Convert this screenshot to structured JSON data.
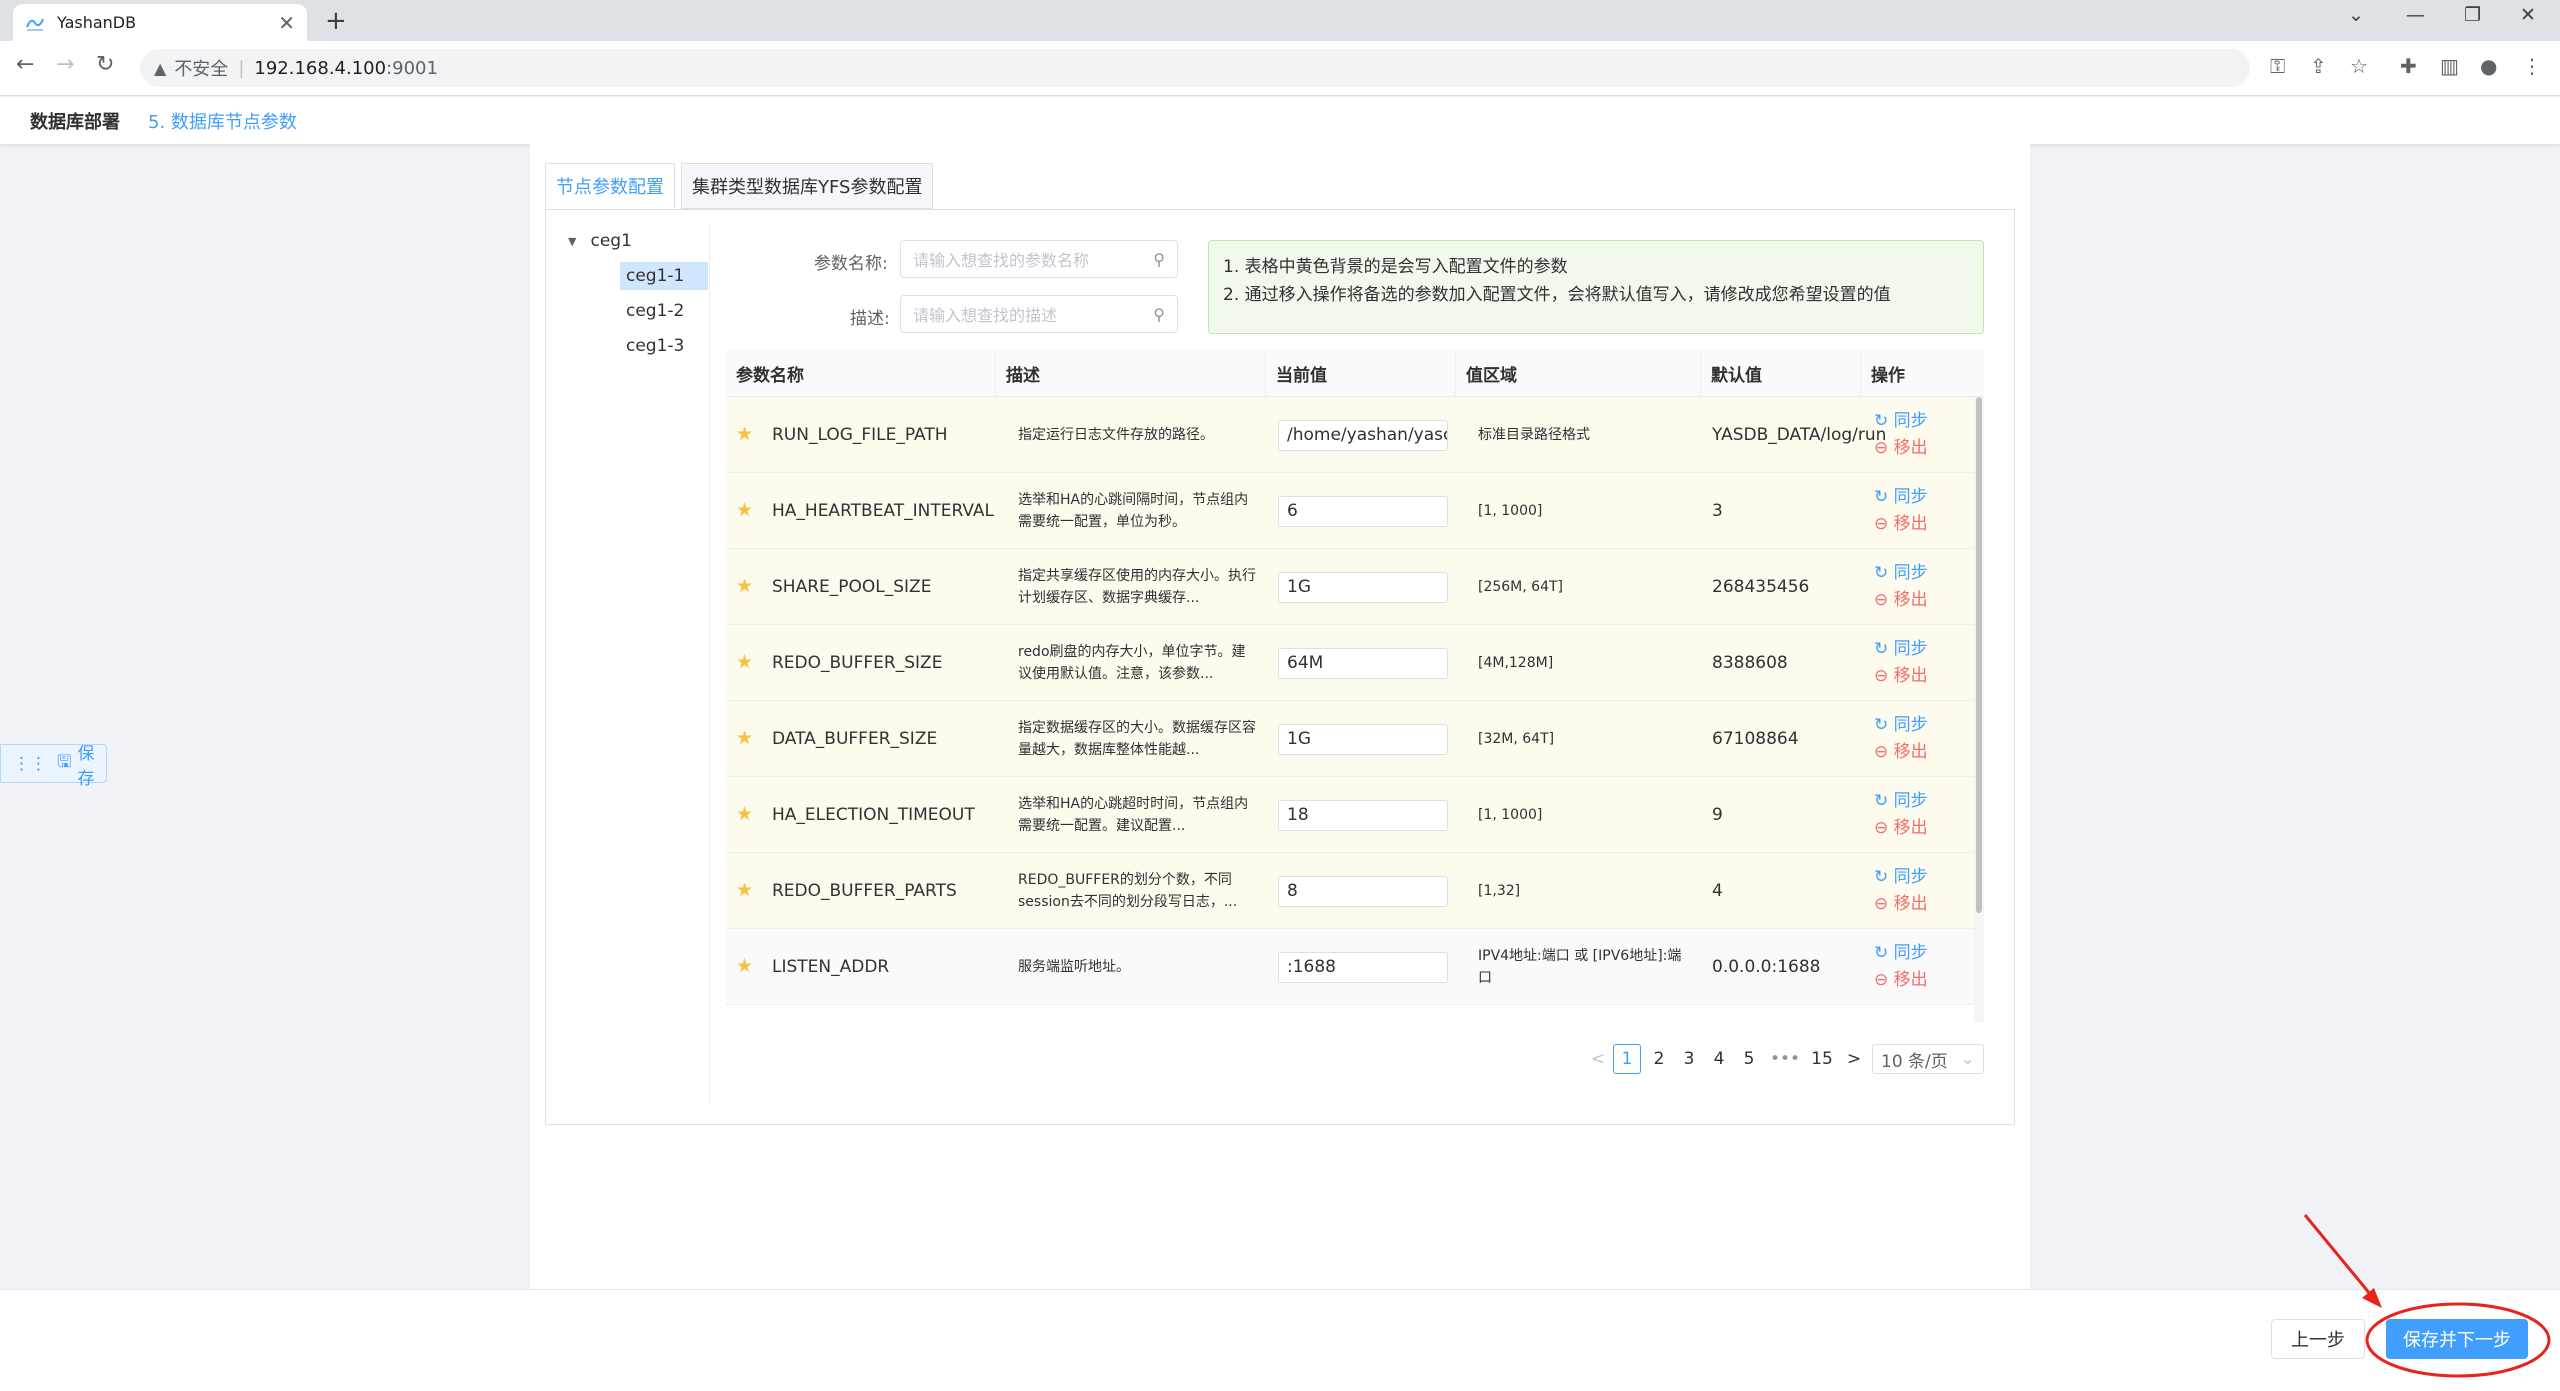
{
  "browser": {
    "tab_title": "YashanDB",
    "insecure_label": "不安全",
    "separator": "|",
    "host": "192.168.4.100",
    "port": ":9001"
  },
  "app": {
    "breadcrumb_root": "数据库部署",
    "breadcrumb_current": "5. 数据库节点参数",
    "float_save_label": "保存"
  },
  "tabs": [
    "节点参数配置",
    "集群类型数据库YFS参数配置"
  ],
  "tree": {
    "root": "ceg1",
    "children": [
      "ceg1-1",
      "ceg1-2",
      "ceg1-3"
    ],
    "selected": "ceg1-1"
  },
  "search": {
    "name_label": "参数名称:",
    "name_placeholder": "请输入想查找的参数名称",
    "desc_label": "描述:",
    "desc_placeholder": "请输入想查找的描述"
  },
  "notice": {
    "line1": "1. 表格中黄色背景的是会写入配置文件的参数",
    "line2": "2. 通过移入操作将备选的参数加入配置文件，会将默认值写入，请修改成您希望设置的值"
  },
  "table": {
    "headers": [
      "参数名称",
      "描述",
      "当前值",
      "值区域",
      "默认值",
      "操作"
    ],
    "sync_label": "同步",
    "remove_label": "移出",
    "rows": [
      {
        "name": "RUN_LOG_FILE_PATH",
        "desc": "指定运行日志文件存放的路径。",
        "value": "/home/yashan/yasc",
        "range": "标准目录路径格式",
        "default": "YASDB_DATA/log/run",
        "in_config": true
      },
      {
        "name": "HA_HEARTBEAT_INTERVAL",
        "desc": "选举和HA的心跳间隔时间，节点组内需要统一配置，单位为秒。",
        "value": "6",
        "range": "[1, 1000]",
        "default": "3",
        "in_config": true
      },
      {
        "name": "SHARE_POOL_SIZE",
        "desc": "指定共享缓存区使用的内存大小。执行计划缓存区、数据字典缓存...",
        "value": "1G",
        "range": "[256M, 64T]",
        "default": "268435456",
        "in_config": true
      },
      {
        "name": "REDO_BUFFER_SIZE",
        "desc": "redo刷盘的内存大小，单位字节。建议使用默认值。注意，该参数...",
        "value": "64M",
        "range": "[4M,128M]",
        "default": "8388608",
        "in_config": true
      },
      {
        "name": "DATA_BUFFER_SIZE",
        "desc": "指定数据缓存区的大小。数据缓存区容量越大，数据库整体性能越...",
        "value": "1G",
        "range": "[32M, 64T]",
        "default": "67108864",
        "in_config": true
      },
      {
        "name": "HA_ELECTION_TIMEOUT",
        "desc": "选举和HA的心跳超时时间，节点组内需要统一配置。建议配置...",
        "value": "18",
        "range": "[1, 1000]",
        "default": "9",
        "in_config": true
      },
      {
        "name": "REDO_BUFFER_PARTS",
        "desc": "REDO_BUFFER的划分个数，不同session去不同的划分段写日志，...",
        "value": "8",
        "range": "[1,32]",
        "default": "4",
        "in_config": true
      },
      {
        "name": "LISTEN_ADDR",
        "desc": "服务端监听地址。",
        "value": ":1688",
        "range": "IPV4地址:端口 或 [IPV6地址]:端口",
        "default": "0.0.0.0:1688",
        "in_config": false
      }
    ]
  },
  "pagination": {
    "prev": "<",
    "pages": [
      "1",
      "2",
      "3",
      "4",
      "5",
      "•••",
      "15"
    ],
    "current": "1",
    "next": ">",
    "page_size": "10 条/页"
  },
  "footer": {
    "prev_label": "上一步",
    "next_label": "保存并下一步"
  },
  "colors": {
    "accent": "#409eff",
    "config_row_bg": "#fdfaee",
    "remove": "#f56c6c",
    "annotation": "#e8231a"
  }
}
